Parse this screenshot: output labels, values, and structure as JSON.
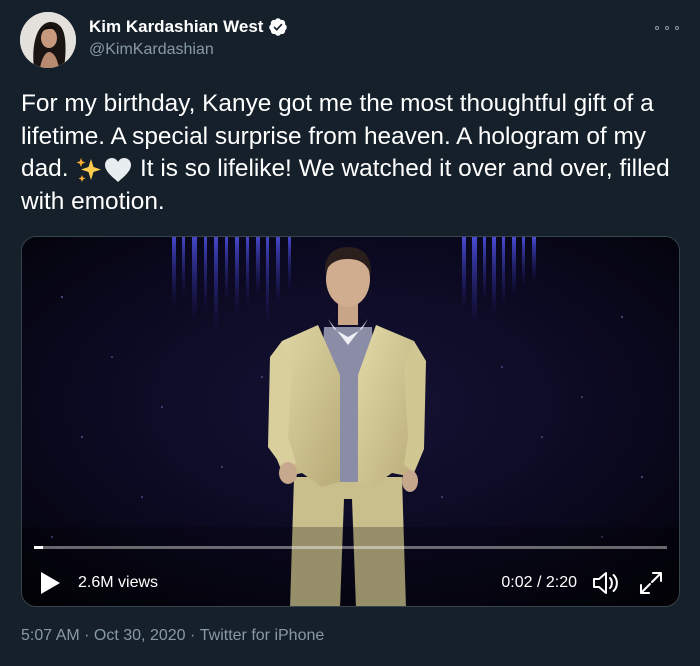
{
  "author": {
    "display_name": "Kim Kardashian West",
    "handle": "@KimKardashian",
    "verified": true,
    "avatar_icon": "profile-photo"
  },
  "tweet": {
    "text_part1": "For my birthday, Kanye got me the most thoughtful gift of a lifetime. A special surprise from heaven. A hologram of my dad. ",
    "emoji1": "sparkles",
    "emoji2": "white-heart",
    "text_part2": " It is so lifelike! We watched it over and over, filled with emotion."
  },
  "video": {
    "views": "2.6M views",
    "time": "0:02 / 2:20",
    "progress_fraction": 0.014,
    "controls": [
      "play-icon",
      "volume-icon",
      "expand-icon"
    ]
  },
  "meta": {
    "time": "5:07 AM",
    "sep1": " · ",
    "date": "Oct 30, 2020",
    "sep2": " · ",
    "source": "Twitter for iPhone"
  },
  "colors": {
    "background": "#15202b",
    "secondary_text": "#8899a6",
    "verified_badge": "#ffffff",
    "border": "#38444d"
  }
}
